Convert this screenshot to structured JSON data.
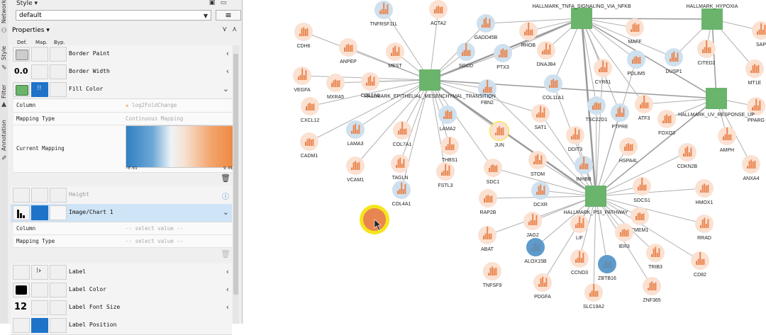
{
  "side_tabs": [
    {
      "label": "Network",
      "icon": "network-icon"
    },
    {
      "label": "Style",
      "icon": "style-icon"
    },
    {
      "label": "Filter",
      "icon": "filter-icon"
    },
    {
      "label": "Annotation",
      "icon": "annotation-icon"
    }
  ],
  "panel": {
    "title": "Style",
    "style_select": "default",
    "properties_label": "Properties",
    "col_def": "Def.",
    "col_map": "Map.",
    "col_byp": "Byp.",
    "rows": {
      "border_paint": "Border Paint",
      "border_width": "Border Width",
      "border_width_value": "0.0",
      "fill_color": "Fill Color",
      "height": "Height",
      "image_chart": "Image/Chart 1",
      "label": "Label",
      "label_color": "Label Color",
      "label_font_size": "Label Font Size",
      "label_font_size_value": "12",
      "label_position": "Label Position"
    },
    "fill_mapping": {
      "column_key": "Column",
      "column_value": "log2FoldChange",
      "type_key": "Mapping Type",
      "type_value": "Continuous Mapping",
      "current_key": "Current Mapping",
      "min": "-0.61",
      "max": "9.01"
    },
    "chart_mapping": {
      "column_key": "Column",
      "column_value": "-- select value --",
      "type_key": "Mapping Type",
      "type_value": "-- select value --"
    }
  },
  "colors": {
    "hub": "#6ab46c",
    "orange": "#e9864f",
    "blue": "#4a8ec4",
    "highlight": "#f5e51c"
  },
  "network": {
    "hubs": [
      {
        "label": "HALLMARK_EPITHELIAL_MESENCHYMAL_TRANSITION"
      },
      {
        "label": "HALLMARK_TNFA_SIGNALING_VIA_NFKB"
      },
      {
        "label": "HALLMARK_HYPOXIA"
      },
      {
        "label": "HALLMARK_UV_RESPONSE_UP"
      },
      {
        "label": "HALLMARK_P53_PATHWAY"
      }
    ],
    "genes": [
      "CDH6",
      "TNFRSF11L",
      "ACTA2",
      "GADD45B",
      "RHOB",
      "MAFF",
      "SAP",
      "ANPEP",
      "MEST",
      "SGCD",
      "PTX3",
      "DNAJB4",
      "PDLIM5",
      "DUSP1",
      "CITED2",
      "MT1E",
      "VEGFA",
      "MXRA5",
      "COL1A1",
      "FBN2",
      "COL11A1",
      "CYR61",
      "CXCL12",
      "LAMA3",
      "COL7A1",
      "LAMA2",
      "SAT1",
      "TSC22D1",
      "PTPRE",
      "ATF3",
      "FOXO3",
      "PPARG",
      "CADM1",
      "TAGLN",
      "THBS1",
      "JUN",
      "DDIT3",
      "HSPA4L",
      "CDKN2B",
      "AMPH",
      "VCAM1",
      "FSTL3",
      "SDC1",
      "STOM",
      "INHBB",
      "ANXA4",
      "COL4A1",
      "RAP2B",
      "DCXR",
      "SOCS1",
      "HMOX1",
      "JAG2",
      "TMEM1",
      "RRAD",
      "ABAT",
      "ALOX15B",
      "LIF",
      "IER3",
      "TRIB3",
      "CD82",
      "TNFSF9",
      "CCND3",
      "ZBTB16",
      "PDGFA",
      "SLC19A2",
      "ZNF365"
    ]
  }
}
